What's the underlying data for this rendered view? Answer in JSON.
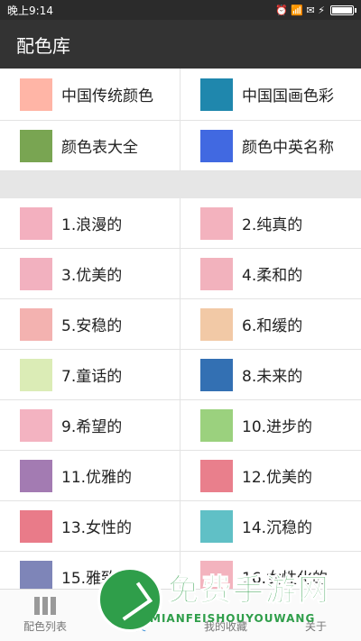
{
  "status_bar": {
    "time": "晚上9:14",
    "icons_text": "⏰ 📶 ✉ ⚡"
  },
  "app_bar": {
    "title": "配色库"
  },
  "top_categories": [
    {
      "label": "中国传统颜色",
      "color": "#ffb5a6"
    },
    {
      "label": "中国国画色彩",
      "color": "#1f87ad"
    },
    {
      "label": "颜色表大全",
      "color": "#79a552"
    },
    {
      "label": "颜色中英名称",
      "color": "#4169e1"
    }
  ],
  "palettes": [
    {
      "label": "1.浪漫的",
      "color": "#f3b0bf"
    },
    {
      "label": "2.纯真的",
      "color": "#f3b2be"
    },
    {
      "label": "3.优美的",
      "color": "#f2b1bf"
    },
    {
      "label": "4.柔和的",
      "color": "#f2b2bd"
    },
    {
      "label": "5.安稳的",
      "color": "#f3b2b0"
    },
    {
      "label": "6.和缓的",
      "color": "#f2c9a6"
    },
    {
      "label": "7.童话的",
      "color": "#dbecb6"
    },
    {
      "label": "8.未来的",
      "color": "#3370b3"
    },
    {
      "label": "9.希望的",
      "color": "#f3b3c1"
    },
    {
      "label": "10.进步的",
      "color": "#9bd17e"
    },
    {
      "label": "11.优雅的",
      "color": "#a37bb2"
    },
    {
      "label": "12.优美的",
      "color": "#e97f8c"
    },
    {
      "label": "13.女性的",
      "color": "#e97b89"
    },
    {
      "label": "14.沉稳的",
      "color": "#60c0c6"
    },
    {
      "label": "15.雅致的",
      "color": "#7e85b8"
    },
    {
      "label": "16.女性化的",
      "color": "#f3b3be"
    }
  ],
  "bottom_nav": [
    {
      "label": "配色列表",
      "active": false
    },
    {
      "label": "分类",
      "active": true
    },
    {
      "label": "我的收藏",
      "active": false
    },
    {
      "label": "关于",
      "active": false
    }
  ],
  "watermark": {
    "title": "免费手游网",
    "subtitle": "MIANFEISHOUYOUWANG"
  }
}
